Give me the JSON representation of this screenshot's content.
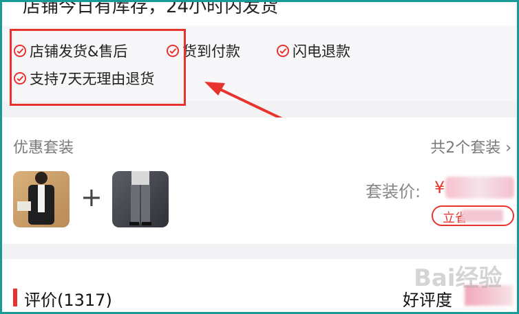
{
  "top_strip": {
    "partial_text": "店铺今日有库存，24小时内发货"
  },
  "services": [
    {
      "label": "店铺发货&售后"
    },
    {
      "label": "货到付款"
    },
    {
      "label": "闪电退款"
    },
    {
      "label": "支持7天无理由退货"
    }
  ],
  "bundle": {
    "title": "优惠套装",
    "count": "共2个套装 ›",
    "plus": "+",
    "price_label": "套装价:",
    "price_currency": "¥",
    "save_text": "立省"
  },
  "reviews": {
    "title": "评价(1317)",
    "good_rate_label": "好评度"
  },
  "watermark": "Bai经验",
  "colors": {
    "accent": "#e8322d",
    "frame": "#1a9a95"
  }
}
